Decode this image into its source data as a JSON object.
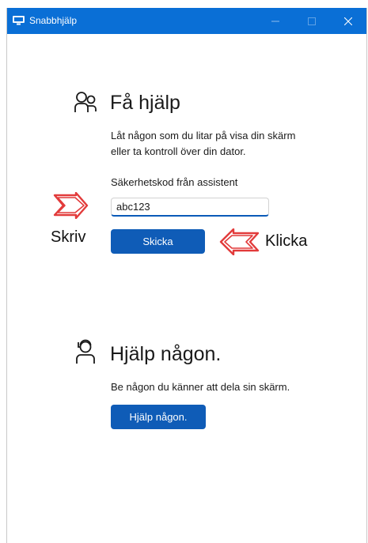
{
  "window": {
    "title": "Snabbhjälp",
    "accent_color": "#0a6fd6"
  },
  "get_help": {
    "icon": "people-icon",
    "heading": "Få hjälp",
    "description_line1": "Låt någon som du litar på visa din skärm",
    "description_line2": "eller ta kontroll över din dator.",
    "code_label": "Säkerhetskod från assistent",
    "code_value": "abc123",
    "submit_label": "Skicka"
  },
  "give_help": {
    "icon": "person-support-icon",
    "heading": "Hjälp någon.",
    "description": "Be någon du känner att dela sin skärm.",
    "button_label": "Hjälp någon."
  },
  "annotations": {
    "type_label": "Skriv",
    "click_label": "Klicka",
    "arrow_color": "#e23b3b"
  },
  "colors": {
    "button_blue": "#0f5cb7"
  }
}
